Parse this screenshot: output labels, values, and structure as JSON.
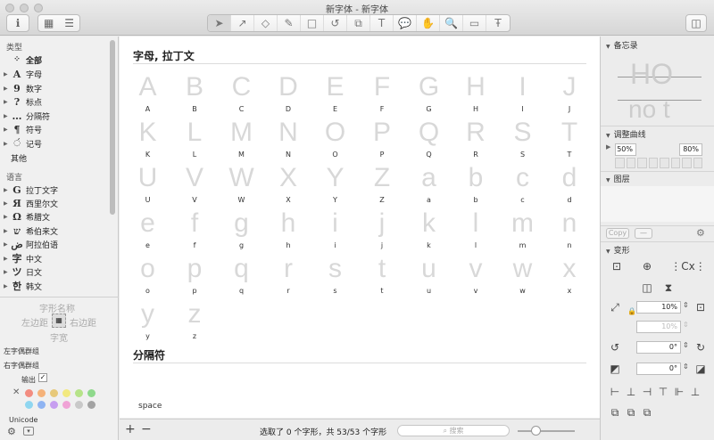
{
  "window": {
    "title": "新字体 - 新字体"
  },
  "sidebar": {
    "category_header": "类型",
    "categories": [
      {
        "glyph": "",
        "label": "全部"
      },
      {
        "glyph": "A",
        "label": "字母"
      },
      {
        "glyph": "9",
        "label": "数字"
      },
      {
        "glyph": "?",
        "label": "标点"
      },
      {
        "glyph": "…",
        "label": "分隔符"
      },
      {
        "glyph": "¶",
        "label": "符号"
      },
      {
        "glyph": "",
        "label": "记号"
      },
      {
        "glyph": "",
        "label": "其他"
      }
    ],
    "language_header": "语言",
    "languages": [
      {
        "glyph": "G",
        "label": "拉丁文字"
      },
      {
        "glyph": "Я",
        "label": "西里尔文"
      },
      {
        "glyph": "Ω",
        "label": "希腊文"
      },
      {
        "glyph": "ש",
        "label": "希伯来文"
      },
      {
        "glyph": "ض",
        "label": "阿拉伯语"
      },
      {
        "glyph": "字",
        "label": "中文"
      },
      {
        "glyph": "ツ",
        "label": "日文"
      },
      {
        "glyph": "한",
        "label": "韩文"
      }
    ],
    "metrics": {
      "glyph_name": "字形名称",
      "left_sidebearing": "左边距",
      "right_sidebearing": "右边距",
      "width": "字宽"
    },
    "left_group": "左字偶群组",
    "right_group": "右字偶群组",
    "export_label": "输出",
    "unicode_label": "Unicode"
  },
  "main": {
    "sections": [
      {
        "title": "字母, 拉丁文",
        "glyphs": [
          "A",
          "B",
          "C",
          "D",
          "E",
          "F",
          "G",
          "H",
          "I",
          "J",
          "K",
          "L",
          "M",
          "N",
          "O",
          "P",
          "Q",
          "R",
          "S",
          "T",
          "U",
          "V",
          "W",
          "X",
          "Y",
          "Z",
          "a",
          "b",
          "c",
          "d",
          "e",
          "f",
          "g",
          "h",
          "i",
          "j",
          "k",
          "l",
          "m",
          "n",
          "o",
          "p",
          "q",
          "r",
          "s",
          "t",
          "u",
          "v",
          "w",
          "x",
          "y",
          "z"
        ]
      },
      {
        "title": "分隔符",
        "glyphs": [
          "space"
        ]
      }
    ]
  },
  "bottom": {
    "status": "选取了 0 个字形，共 53/53 个字形",
    "search_placeholder": "搜索",
    "add_label": "+",
    "remove_label": "−"
  },
  "right_panel": {
    "memo_header": "备忘录",
    "preview_text_1": "HO",
    "preview_text_2": "no t",
    "curve_header": "调整曲线",
    "curve_left": "50%",
    "curve_right": "80%",
    "layers_header": "图层",
    "copy_button": "Copy",
    "transform_header": "变形",
    "scale_value": "10%",
    "scale_value_2": "10%",
    "rotate_value": "0°",
    "slant_value": "0°"
  },
  "colors": {
    "swatches": [
      "#f28c80",
      "#f5b27a",
      "#e7c97a",
      "#f2e97f",
      "#b6e389",
      "#8fd98c",
      "#8fd6f0",
      "#8fb4f2",
      "#c79ef0",
      "#f0a3d6",
      "#c9c9c9",
      "#a3a3a3"
    ]
  }
}
